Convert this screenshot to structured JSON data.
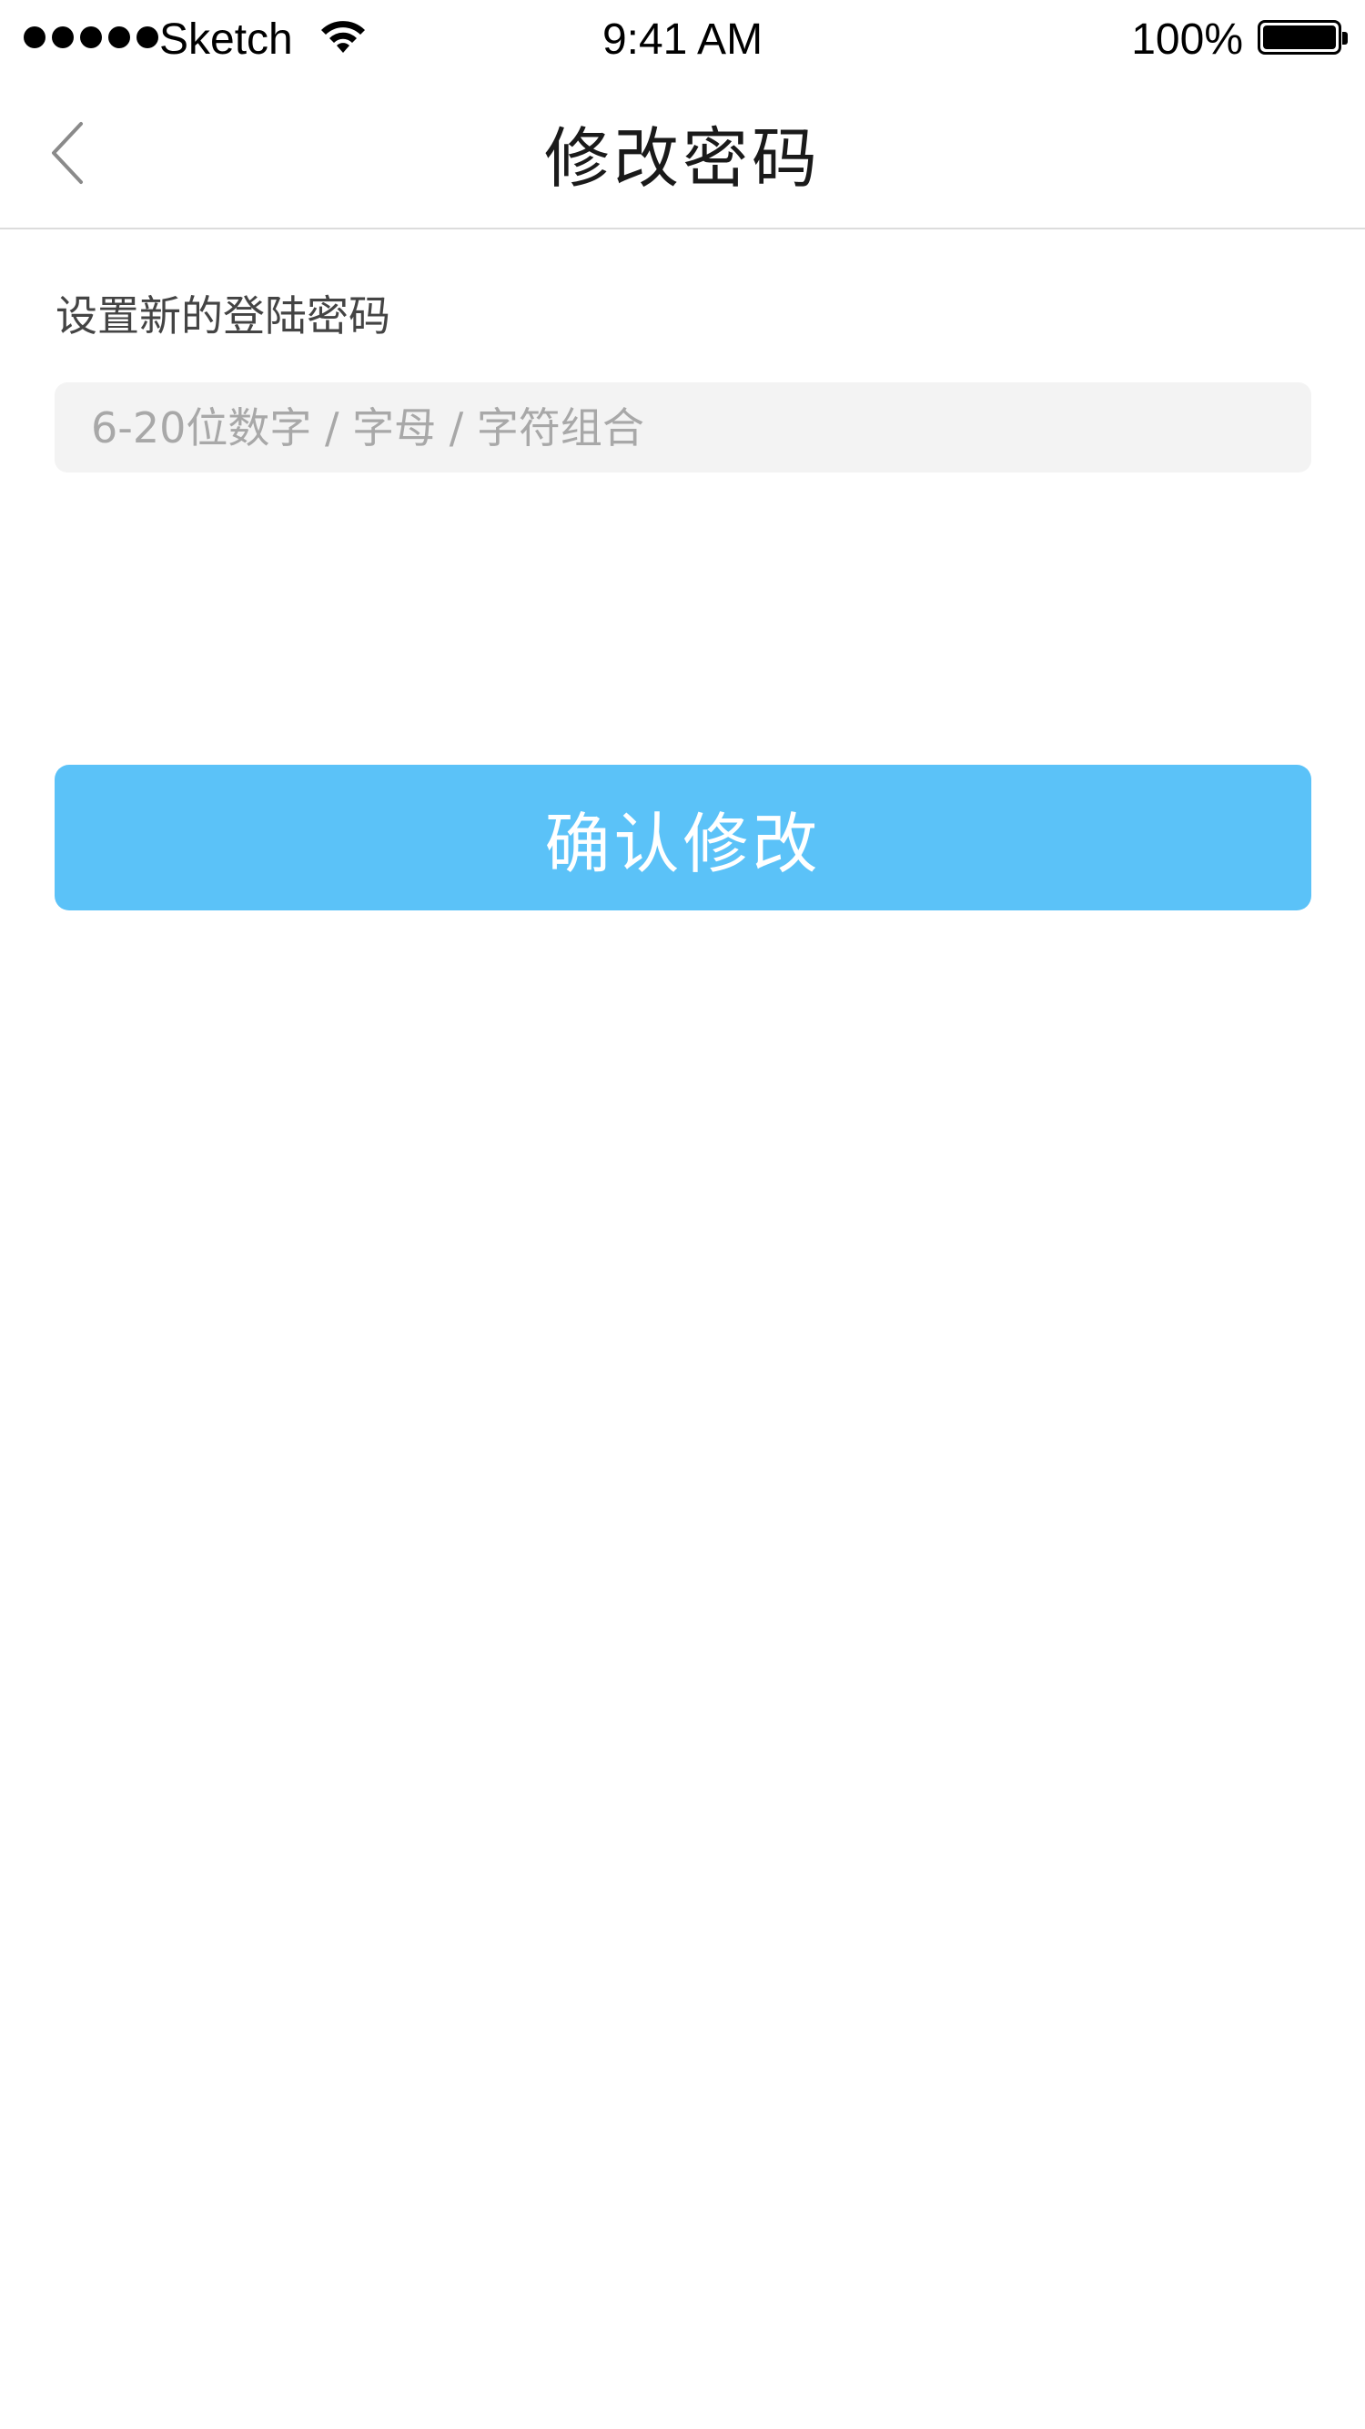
{
  "status_bar": {
    "carrier": "Sketch",
    "time": "9:41 AM",
    "battery": "100%",
    "signal_icon": "signal-dots-icon",
    "wifi_icon": "wifi-icon",
    "battery_icon": "battery-icon"
  },
  "nav": {
    "back_icon": "chevron-left-icon",
    "title": "修改密码"
  },
  "form": {
    "label": "设置新的登陆密码",
    "password_placeholder": "6-20位数字 / 字母 / 字符组合",
    "password_value": ""
  },
  "actions": {
    "confirm_label": "确认修改"
  },
  "colors": {
    "accent": "#5bc2f8",
    "input_bg": "#f3f3f3",
    "placeholder": "#a8a8a8",
    "divider": "#dcdcdc"
  }
}
